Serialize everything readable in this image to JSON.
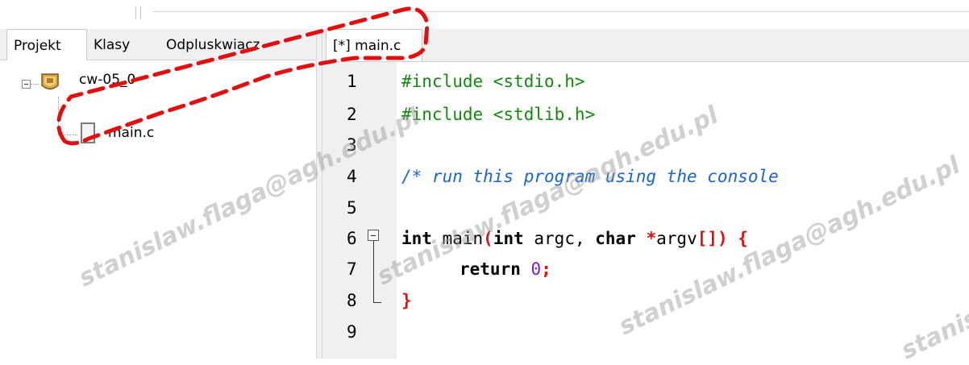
{
  "left_panel": {
    "tabs": [
      {
        "label": "Projekt",
        "active": true
      },
      {
        "label": "Klasy",
        "active": false
      },
      {
        "label": "Odpluskwiacz",
        "active": false
      }
    ],
    "tree": {
      "project_label": "cw-05_0",
      "project_icon": "project-folder-icon",
      "files": [
        {
          "label": "main.c",
          "icon": "file-icon"
        }
      ]
    }
  },
  "editor": {
    "tab_label": "[*] main.c",
    "line_numbers": [
      "1",
      "2",
      "3",
      "4",
      "5",
      "6",
      "7",
      "8",
      "9"
    ],
    "lines": {
      "l1": "#include <stdio.h>",
      "l2": "#include <stdlib.h>",
      "l4": "/* run this program using the console",
      "l6_kw1": "int",
      "l6_fn": " main",
      "l6_p1": "(",
      "l6_kw2": "int",
      "l6_mid": " argc, ",
      "l6_kw3": "char",
      "l6_star": " *",
      "l6_arg": "argv",
      "l6_br": "[])",
      "l6_brace": " {",
      "l7_kw": "return",
      "l7_num": "0",
      "l7_semi": ";",
      "l8_brace": "}"
    }
  },
  "watermark": "stanislaw.flaga@agh.edu.pl",
  "colors": {
    "preprocessor": "#15880f",
    "comment": "#1b65c8",
    "number": "#8b1bb0",
    "symbol": "#e01010",
    "highlight_dash": "#e01010"
  }
}
